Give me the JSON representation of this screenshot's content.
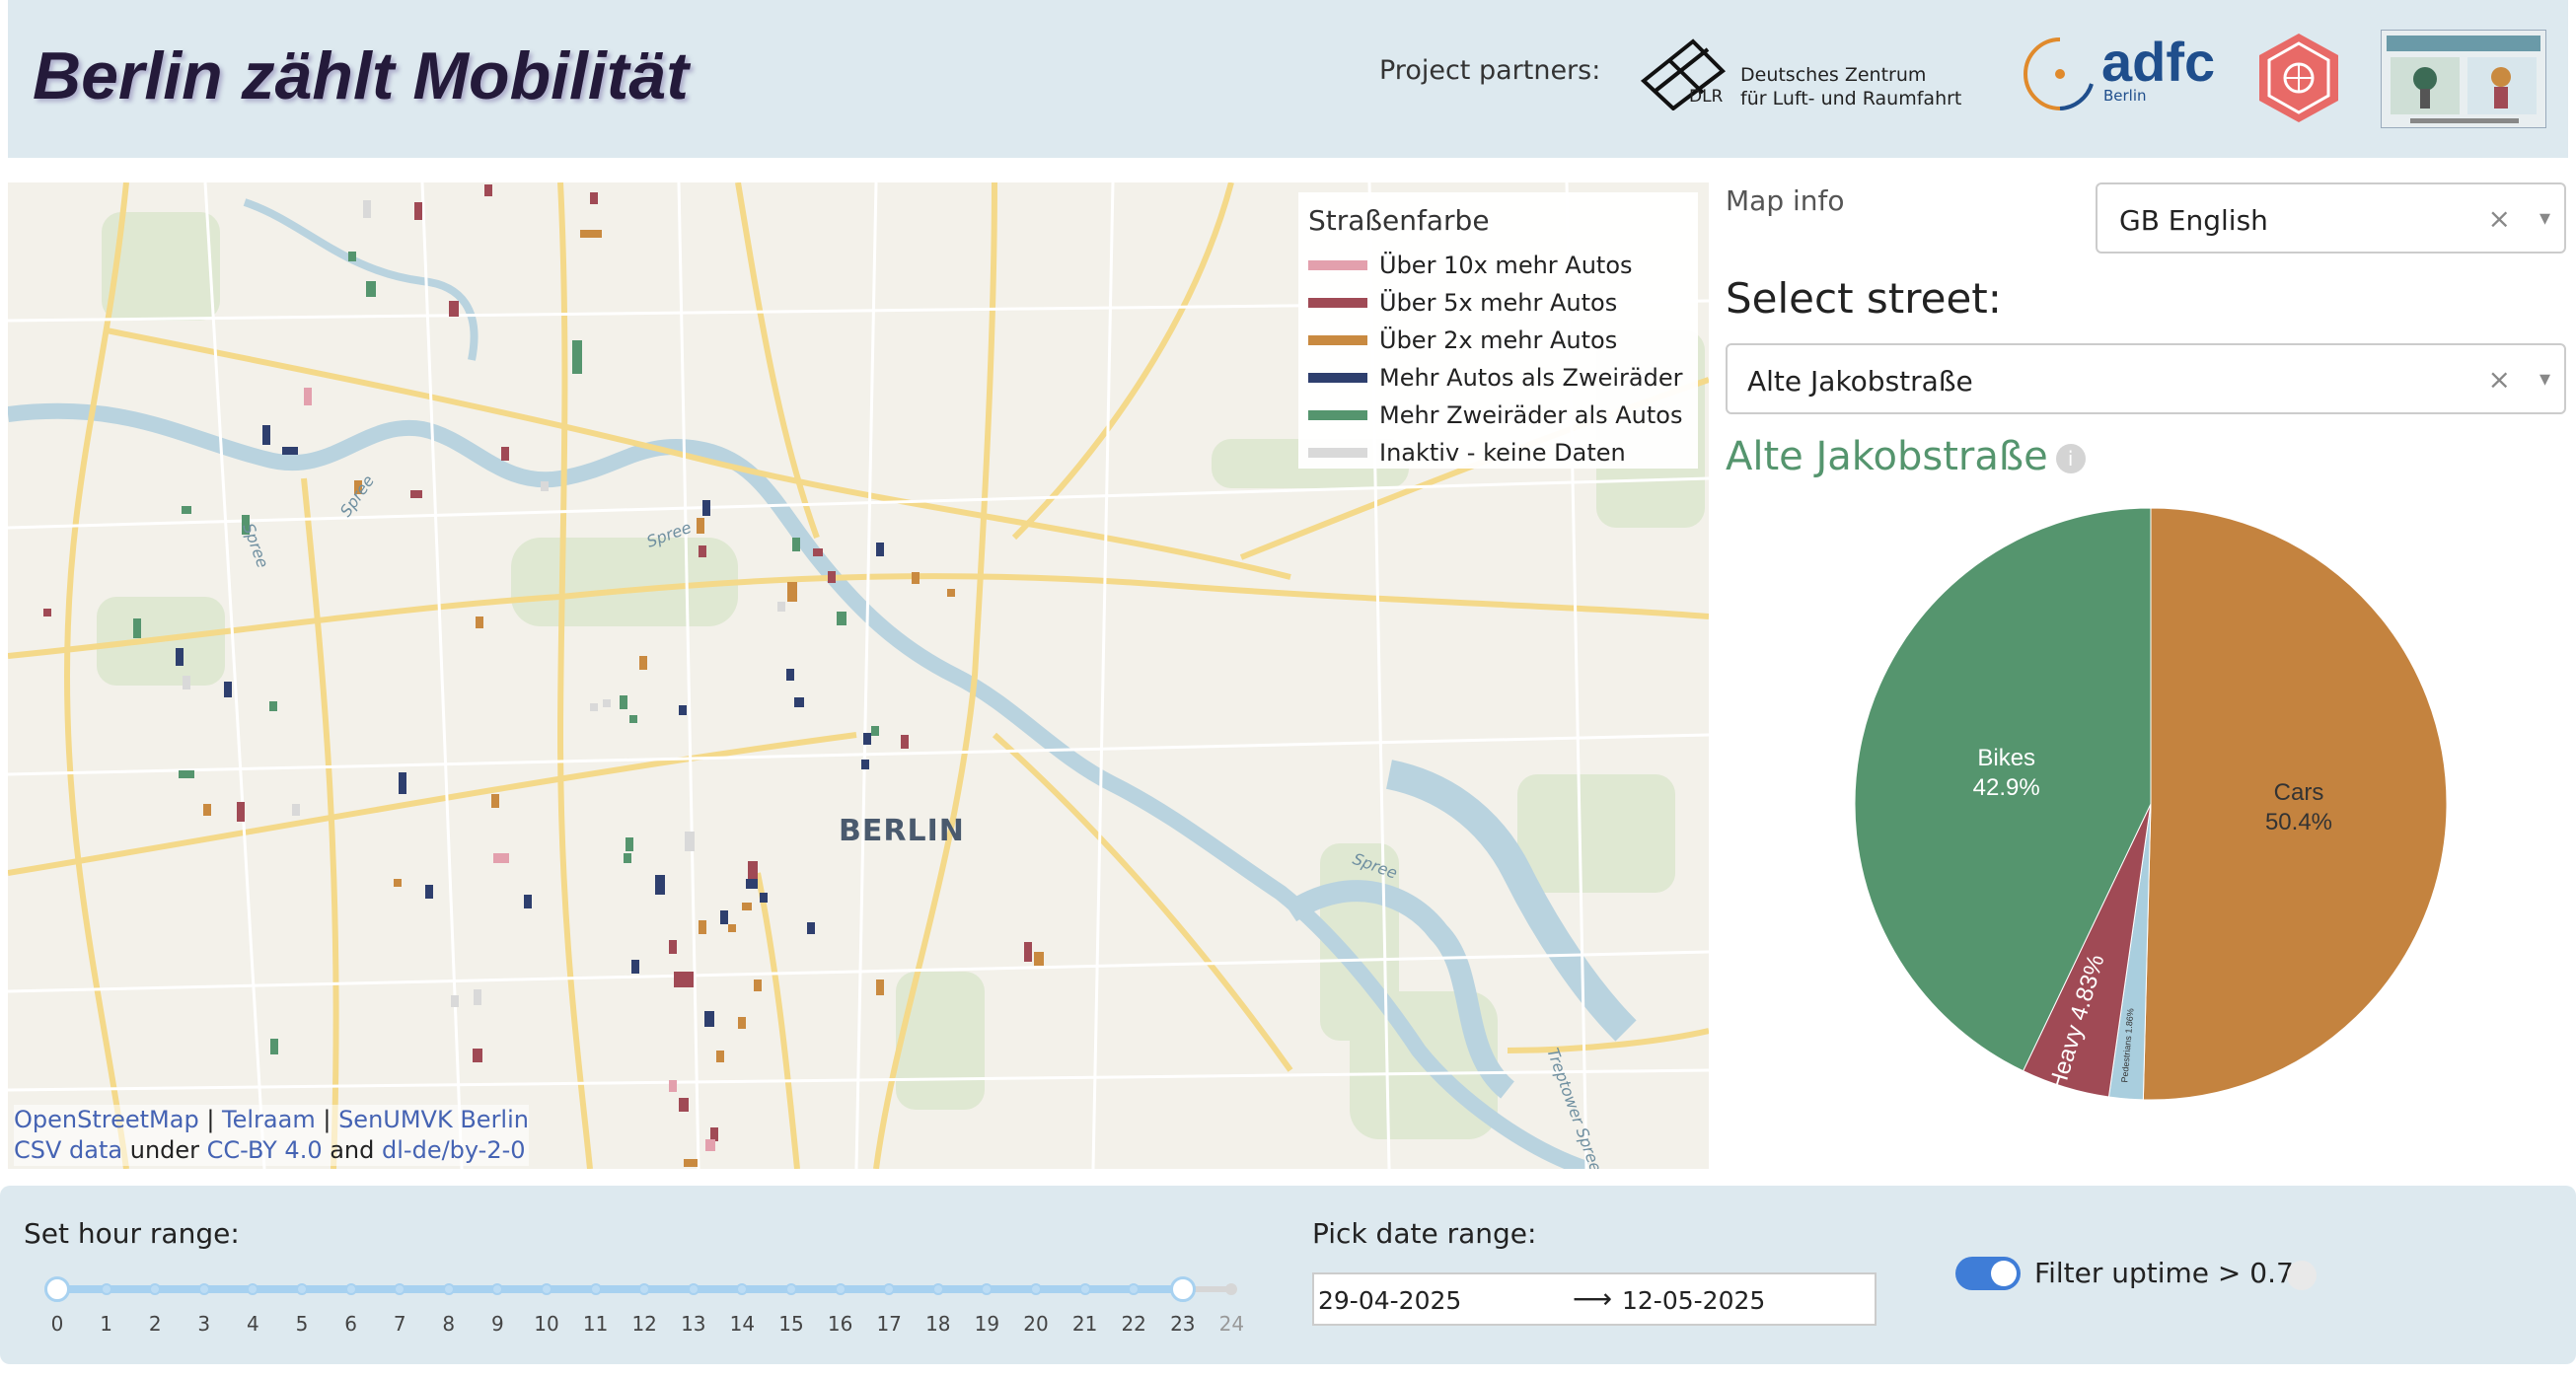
{
  "header": {
    "title": "Berlin zählt Mobilität",
    "partners_label": "Project partners:",
    "dlr_line1": "Deutsches Zentrum",
    "dlr_line2": "für Luft- und Raumfahrt",
    "dlr_abbr": "DLR",
    "adfc_word": "adfc",
    "adfc_sub": "Berlin"
  },
  "map": {
    "city_label": "BERLIN",
    "legend": {
      "title": "Straßenfarbe",
      "items": [
        {
          "label": "Über 10x mehr Autos",
          "color": "#e3a0ad"
        },
        {
          "label": "Über 5x mehr Autos",
          "color": "#a04a55"
        },
        {
          "label": "Über 2x mehr Autos",
          "color": "#c98a40"
        },
        {
          "label": "Mehr Autos als Zweiräder",
          "color": "#2e3f6e"
        },
        {
          "label": "Mehr Zweiräder als Autos",
          "color": "#55956e"
        },
        {
          "label": "Inaktiv - keine Daten",
          "color": "#d9d9d9"
        }
      ]
    },
    "attribution": {
      "osm": "OpenStreetMap",
      "sep1": " | ",
      "telraam": "Telraam",
      "sep2": " | ",
      "senumvk": "SenUMVK Berlin",
      "csv": "CSV data",
      "under": " under ",
      "ccby": "CC-BY 4.0",
      "and": " and ",
      "dlde": "dl-de/by-2-0"
    },
    "river_labels": [
      "Spree",
      "Spree",
      "Spree",
      "Spree",
      "Treptower Spree"
    ]
  },
  "panel": {
    "map_info": "Map info",
    "language": {
      "value": "GB English"
    },
    "select_street_label": "Select street:",
    "street": {
      "value": "Alte Jakobstraße"
    },
    "street_title": "Alte Jakobstraße",
    "info_icon": "i"
  },
  "chart_data": {
    "type": "pie",
    "title": "",
    "slices": [
      {
        "label": "Cars",
        "value": 50.4,
        "display": "50.4%",
        "color": "#c4833f"
      },
      {
        "label": "Pedestrians",
        "value": 1.86,
        "display": "1.86%",
        "color": "#a9cede"
      },
      {
        "label": "Heavy",
        "value": 4.83,
        "display": "4.83%",
        "color": "#a04a55"
      },
      {
        "label": "Bikes",
        "value": 42.9,
        "display": "42.9%",
        "color": "#55956e"
      }
    ]
  },
  "controls": {
    "hour_label": "Set hour range:",
    "hour_range": {
      "min": 0,
      "max": 24,
      "start": 0,
      "end": 23
    },
    "ticks": [
      "0",
      "1",
      "2",
      "3",
      "4",
      "5",
      "6",
      "7",
      "8",
      "9",
      "10",
      "11",
      "12",
      "13",
      "14",
      "15",
      "16",
      "17",
      "18",
      "19",
      "20",
      "21",
      "22",
      "23",
      "24"
    ],
    "date_label": "Pick date range:",
    "date_start": "29-04-2025",
    "date_end": "12-05-2025",
    "date_arrow": "⟶",
    "uptime_label": "Filter uptime > 0.7",
    "uptime_enabled": true
  }
}
